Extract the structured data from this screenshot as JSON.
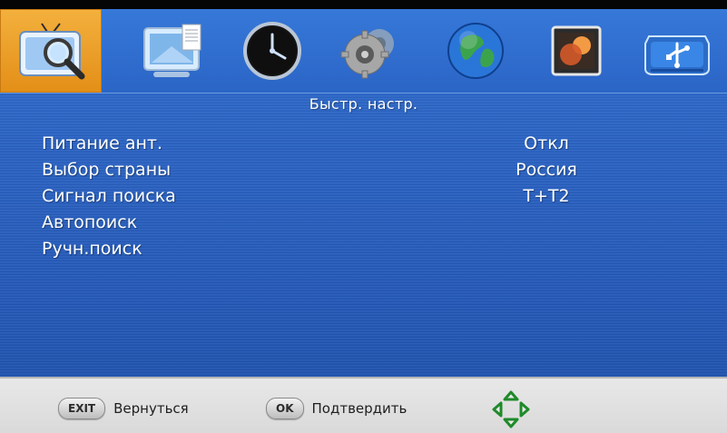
{
  "tabs": [
    {
      "name": "search-tv-icon",
      "active": true
    },
    {
      "name": "picture-icon",
      "active": false
    },
    {
      "name": "clock-icon",
      "active": false
    },
    {
      "name": "settings-gear-icon",
      "active": false
    },
    {
      "name": "globe-icon",
      "active": false
    },
    {
      "name": "photo-icon",
      "active": false
    },
    {
      "name": "usb-icon",
      "active": false
    }
  ],
  "section_title": "Быстр. настр.",
  "menu": {
    "items": [
      {
        "label": "Питание ант.",
        "value": "Откл"
      },
      {
        "label": "Выбор страны",
        "value": "Россия"
      },
      {
        "label": "Сигнал поиска",
        "value": "T+T2"
      },
      {
        "label": "Автопоиск",
        "value": ""
      },
      {
        "label": "Ручн.поиск",
        "value": ""
      }
    ]
  },
  "footer": {
    "exit_key": "EXIT",
    "exit_label": "Вернуться",
    "ok_key": "OK",
    "ok_label": "Подтвердить",
    "nav_icon": "navigation-arrows-icon"
  },
  "colors": {
    "background_blue": "#2a63c4",
    "active_tab_orange": "#f3b03d",
    "footer_gray": "#e0e0e0",
    "text_white": "#ffffff"
  }
}
